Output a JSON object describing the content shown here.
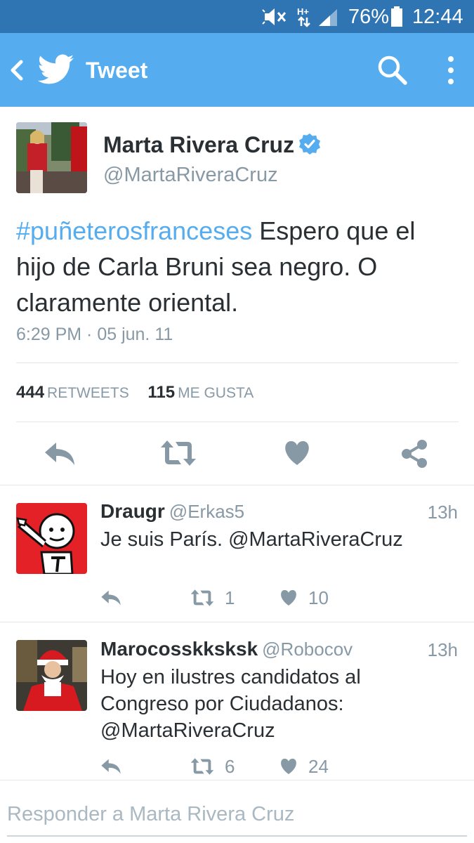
{
  "status_bar": {
    "battery": "76%",
    "time": "12:44",
    "network": "H+"
  },
  "header": {
    "title": "Tweet",
    "icons": [
      "back-icon",
      "twitter-bird-icon",
      "search-icon",
      "more-vert-icon"
    ]
  },
  "tweet": {
    "author_name": "Marta Rivera Cruz",
    "author_handle": "@MartaRiveraCruz",
    "hashtag": "#puñeterosfranceses",
    "text": " Espero que el hijo de Carla Bruni sea negro. O claramente oriental.",
    "timestamp": "6:29 PM · 05 jun. 11",
    "retweets_count": "444",
    "retweets_label": "RETWEETS",
    "likes_count": "115",
    "likes_label": "ME GUSTA",
    "accent": "#55acee"
  },
  "replies": [
    {
      "name": "Draugr",
      "handle": "@Erkas5",
      "time": "13h",
      "text": "Je suis París. @MartaRiveraCruz",
      "retweets": "1",
      "likes": "10"
    },
    {
      "name": "Marocosskksksk",
      "handle": "@Robocov",
      "time": "13h",
      "text": "Hoy en ilustres candidatos al Congreso por Ciudadanos: @MartaRiveraCruz",
      "retweets": "6",
      "likes": "24"
    }
  ],
  "reply_box": {
    "placeholder": "Responder a Marta Rivera Cruz"
  }
}
